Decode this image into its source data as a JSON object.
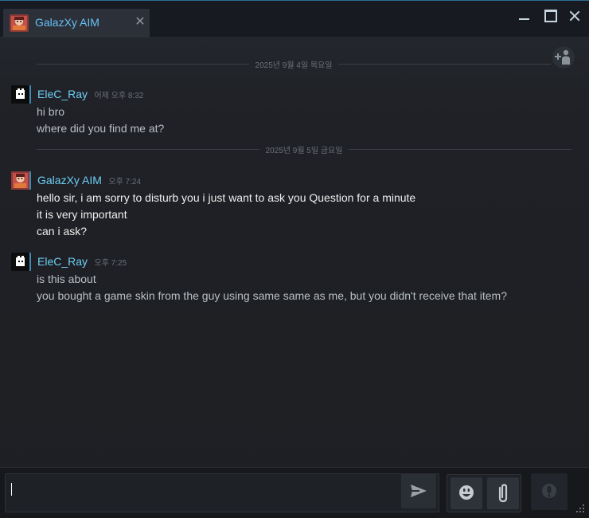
{
  "window": {
    "tab_title": "GalazXy AIM",
    "tab_close_glyph": "✕"
  },
  "icons": {
    "minimize": "minimize-icon",
    "maximize": "maximize-icon",
    "close": "close-icon",
    "add_friend": "add-friend-icon",
    "send": "send-icon",
    "emoji": "emoji-icon",
    "attach": "paperclip-icon",
    "voice": "voice-chat-icon"
  },
  "colors": {
    "accent_name": "#6dcff6",
    "tab_title": "#67c1f5",
    "divider_text": "#6b7079"
  },
  "chat": {
    "dividers": [
      {
        "text": "2025년 9월 4일 목요일"
      },
      {
        "text": "2025년 9월 5일 금요일"
      }
    ],
    "groups": [
      {
        "sender": "EleC_Ray",
        "time": "어제 오후 8:32",
        "lines": [
          "hi bro",
          "where did you find me at?"
        ]
      },
      {
        "sender": "GalazXy AIM",
        "time": "오후 7:24",
        "lines": [
          "hello sir, i am sorry to disturb you i just want to ask you Question for a minute",
          "it is very important",
          "can i ask?"
        ]
      },
      {
        "sender": "EleC_Ray",
        "time": "오후 7:25",
        "lines": [
          "is this about",
          "you bought a game skin from the guy using same same as me, but you didn't receive that item?"
        ]
      }
    ]
  },
  "composer": {
    "value": ""
  }
}
